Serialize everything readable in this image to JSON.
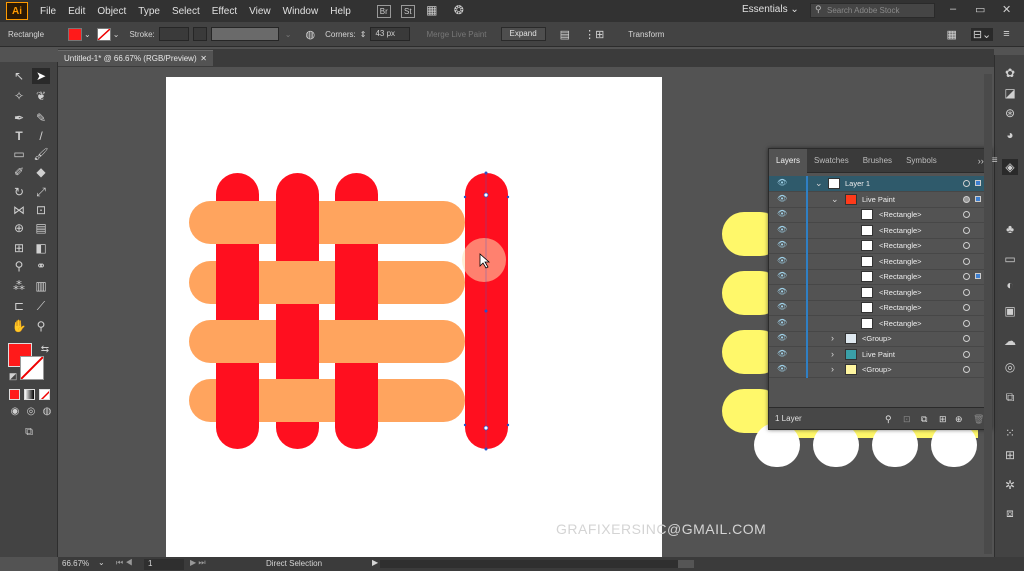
{
  "app": {
    "logo": "Ai",
    "workspace": "Essentials",
    "search_placeholder": "Search Adobe Stock"
  },
  "menu": [
    "File",
    "Edit",
    "Object",
    "Type",
    "Select",
    "Effect",
    "View",
    "Window",
    "Help"
  ],
  "menubar_icons": {
    "bridge": "Br",
    "stock": "St"
  },
  "control_bar": {
    "object_type": "Rectangle",
    "stroke_label": "Stroke:",
    "corners_label": "Corners:",
    "corners_value": "43 px",
    "merge_label": "Merge Live Paint",
    "expand_label": "Expand",
    "transform_label": "Transform",
    "fill_color": "#ff1a1a"
  },
  "document": {
    "tab_title": "Untitled-1* @ 66.67% (RGB/Preview)"
  },
  "status": {
    "zoom": "66.67%",
    "page": "1",
    "tool": "Direct Selection"
  },
  "layers_panel": {
    "tabs": [
      "Layers",
      "Swatches",
      "Brushes",
      "Symbols"
    ],
    "rows": [
      {
        "name": "Layer 1"
      },
      {
        "name": "Live Paint"
      },
      {
        "name": "<Rectangle>"
      },
      {
        "name": "<Rectangle>"
      },
      {
        "name": "<Rectangle>"
      },
      {
        "name": "<Rectangle>"
      },
      {
        "name": "<Rectangle>"
      },
      {
        "name": "<Rectangle>"
      },
      {
        "name": "<Rectangle>"
      },
      {
        "name": "<Rectangle>"
      },
      {
        "name": "<Group>"
      },
      {
        "name": "Live Paint"
      },
      {
        "name": "<Group>"
      }
    ],
    "footer": "1 Layer"
  },
  "artwork_colors": {
    "red": "#ff0f1f",
    "orange": "#ffa45e",
    "yellow": "#fff86a"
  },
  "watermark": "GRAFIXERSINC@GMAIL.COM"
}
